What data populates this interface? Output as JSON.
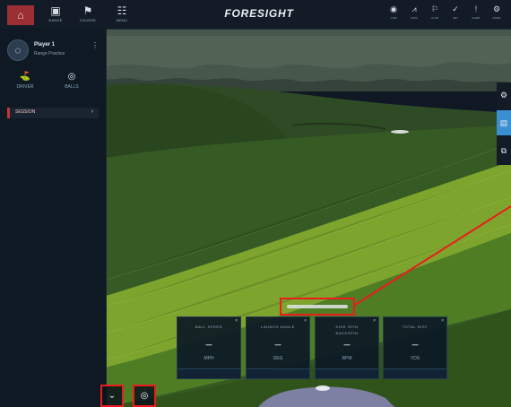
{
  "app": {
    "brand": "FORESIGHT"
  },
  "topbar": {
    "home_icon": "home-icon",
    "nav": [
      {
        "name": "nav-range",
        "icon": "range-icon",
        "label": "RANGE"
      },
      {
        "name": "nav-course",
        "icon": "flag-icon",
        "label": "COURSE"
      },
      {
        "name": "nav-grid",
        "icon": "grid-icon",
        "label": "MENU"
      }
    ],
    "tools": [
      {
        "name": "tool-camera",
        "icon": "camera-icon",
        "label": "CAM"
      },
      {
        "name": "tool-graph",
        "icon": "chart-icon",
        "label": "DATA"
      },
      {
        "name": "tool-club",
        "icon": "club-icon",
        "label": "CLUB"
      },
      {
        "name": "tool-check",
        "icon": "check-icon",
        "label": "SET"
      },
      {
        "name": "tool-alert",
        "icon": "alert-icon",
        "label": "ALERT"
      },
      {
        "name": "tool-settings",
        "icon": "settings-icon",
        "label": "MORE"
      }
    ]
  },
  "sidebar": {
    "player": {
      "name": "Player 1",
      "subtitle": "Range Practice",
      "more": "⋮"
    },
    "quick_actions": [
      {
        "name": "qa-driver",
        "icon": "club-icon",
        "label": "DRIVER"
      },
      {
        "name": "qa-balls",
        "icon": "ball-icon",
        "label": "BALLS"
      }
    ],
    "session": {
      "label": "SESSION",
      "arrow": "›"
    }
  },
  "right_panel": {
    "icons": [
      {
        "name": "right-icon-settings",
        "icon": "settings-icon",
        "active": false
      },
      {
        "name": "right-icon-view",
        "icon": "view-icon",
        "active": true
      },
      {
        "name": "right-icon-layers",
        "icon": "layers-icon",
        "active": false
      }
    ]
  },
  "tiles": [
    {
      "line1": "BALL SPEED",
      "line2": "",
      "value": "—",
      "sub": "MPH"
    },
    {
      "line1": "LAUNCH ANGLE",
      "line2": "",
      "value": "—",
      "sub": "DEG"
    },
    {
      "line1": "SIDE SPIN",
      "line2": "BACKSPIN",
      "value": "—",
      "sub": "RPM"
    },
    {
      "line1": "TOTAL DIST",
      "line2": "",
      "value": "—",
      "sub": "YDS"
    }
  ],
  "bottom_controls": [
    {
      "name": "chevron-toggle",
      "icon": "chevron-down-icon",
      "glyph": "⌄"
    },
    {
      "name": "target-toggle",
      "icon": "target-icon",
      "glyph": "◎"
    }
  ]
}
